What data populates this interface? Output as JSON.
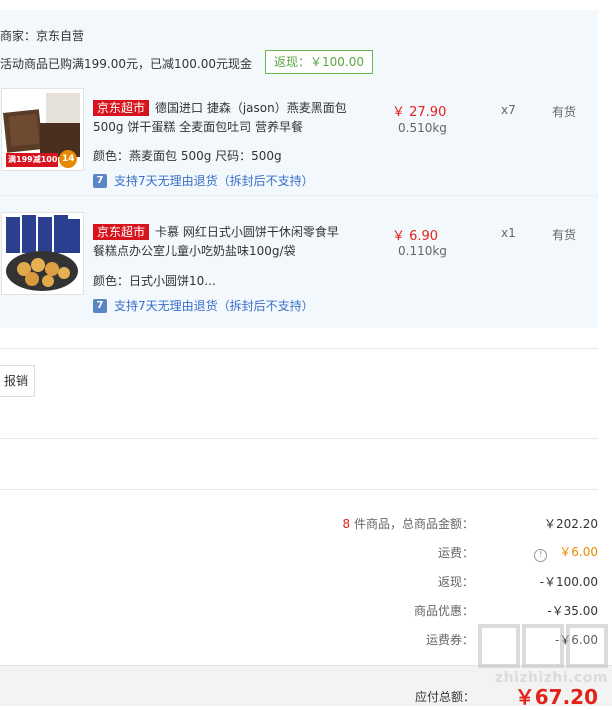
{
  "merchant": {
    "label": "商家：京东自营"
  },
  "promo": {
    "text": "活动商品已购满199.00元，已减100.00元现金",
    "badge": "返现：￥100.00"
  },
  "items": [
    {
      "tag": "京东超市",
      "title": "德国进口 捷森（jason）燕麦黑面包500g 饼干蛋糕 全麦面包吐司 营养早餐",
      "price": "￥ 27.90",
      "weight": "0.510kg",
      "qty": "x7",
      "stock": "有货",
      "attrs": "颜色：燕麦面包 500g  尺码：500g",
      "service": "支持7天无理由退货（拆封后不支持）",
      "thumb_caption": "满199减100",
      "thumb_badge": "14"
    },
    {
      "tag": "京东超市",
      "title": "卡慕 网红日式小圆饼干休闲零食早餐糕点办公室儿童小吃奶盐味100g/袋",
      "price": "￥ 6.90",
      "weight": "0.110kg",
      "qty": "x1",
      "stock": "有货",
      "attrs": "颜色：日式小圆饼10...",
      "service": "支持7天无理由退货（拆封后不支持）"
    }
  ],
  "receipt": {
    "label": "报销"
  },
  "summary": {
    "count": "8",
    "count_suffix": " 件商品，总商品金额：",
    "total": "￥202.20",
    "shipping_label": "运费：",
    "shipping": "￥6.00",
    "cashback_label": "返现：",
    "cashback": "-￥100.00",
    "discount_label": "商品优惠：",
    "discount": "-￥35.00",
    "coupon_label": "运费券：",
    "coupon": "-￥6.00"
  },
  "footer": {
    "payable_label": "应付总额：",
    "payable": "￥67.20"
  },
  "watermark": {
    "text": "zhizhizhi.com"
  },
  "colors": {
    "accent": "#e2231a",
    "panel": "#f3f8fd",
    "green": "#5ca543",
    "link": "#3a6fc7"
  }
}
